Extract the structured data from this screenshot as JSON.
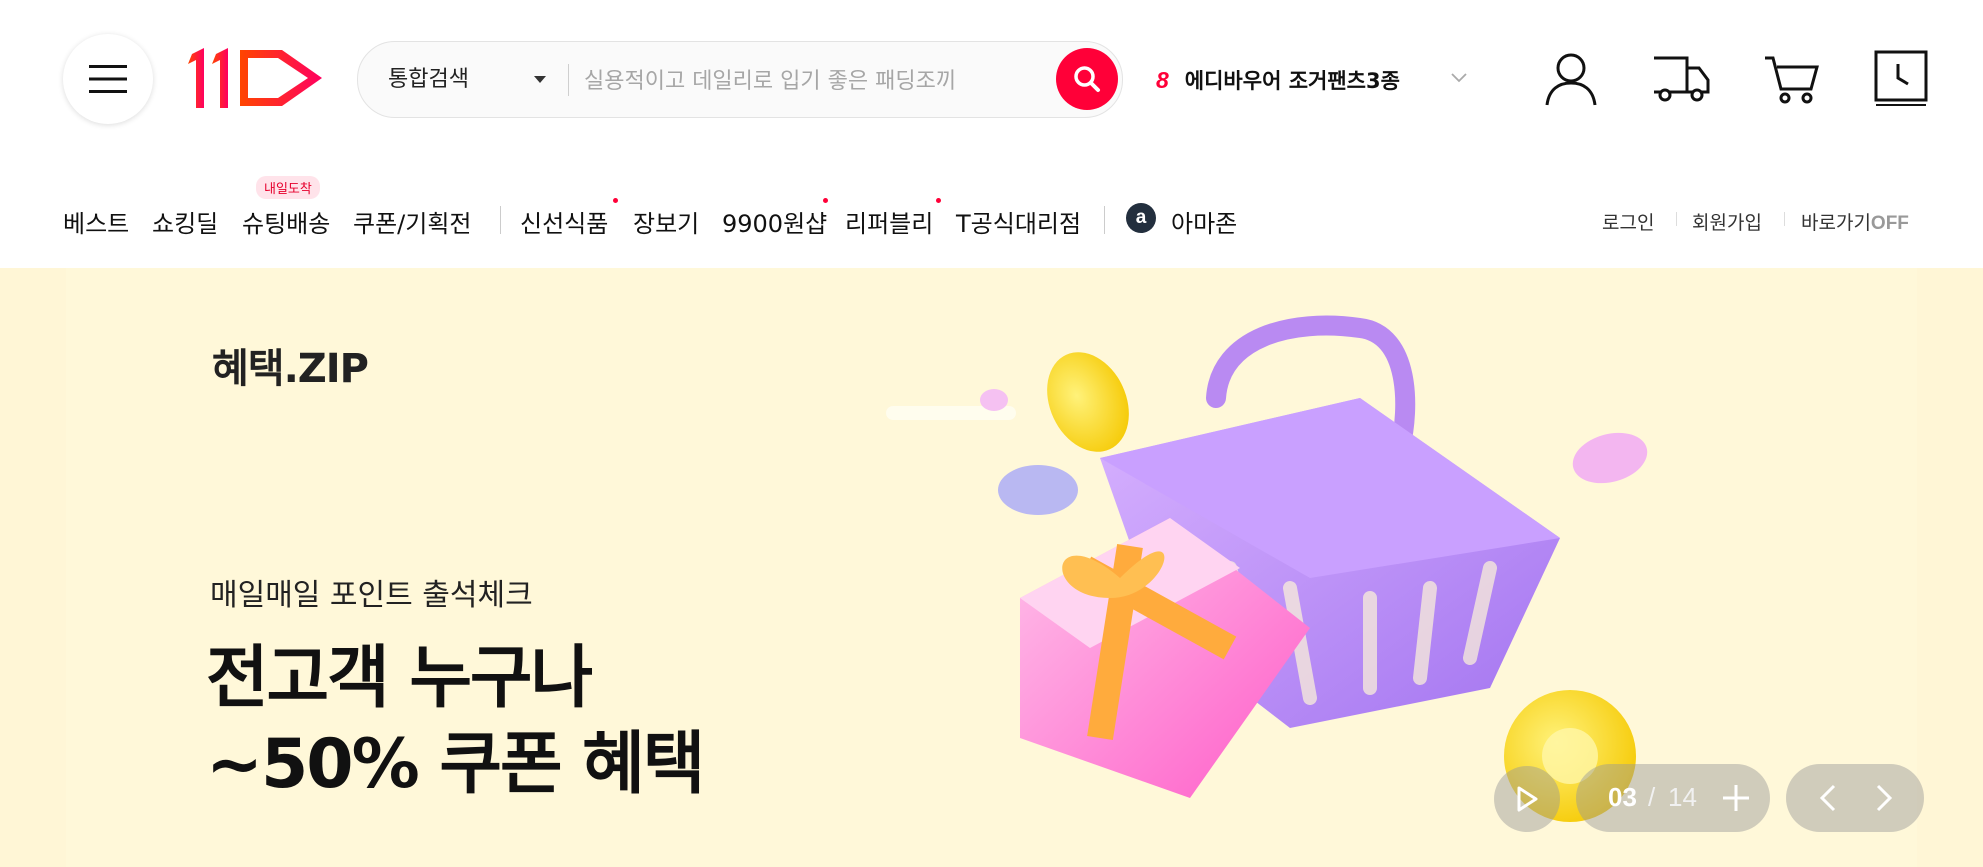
{
  "header": {
    "menu_icon": "hamburger-icon",
    "logo_text": "11",
    "search": {
      "category": "통합검색",
      "placeholder": "실용적이고 데일리로 입기 좋은 패딩조끼",
      "button_icon": "search-icon"
    },
    "rank": {
      "number": "8",
      "keyword": "에디바우어 조거팬츠3종"
    },
    "icons": [
      "user-icon",
      "truck-icon",
      "cart-icon",
      "recent-view-icon"
    ]
  },
  "nav": {
    "items": [
      {
        "label": "베스트"
      },
      {
        "label": "쇼킹딜"
      },
      {
        "label": "슈팅배송",
        "badge": "내일도착"
      },
      {
        "label": "쿠폰/기획전"
      },
      {
        "label": "신선식품"
      },
      {
        "label": "장보기"
      },
      {
        "label": "9900원샵"
      },
      {
        "label": "리퍼블리"
      },
      {
        "label": "T공식대리점"
      },
      {
        "label": "아마존",
        "logo": "a"
      }
    ],
    "utility": {
      "login": "로그인",
      "signup": "회원가입",
      "shortcut": "바로가기",
      "shortcut_state": "OFF"
    }
  },
  "banner": {
    "logo": "혜택.ZIP",
    "subtitle": "매일매일 포인트 출석체크",
    "title_line1": "전고객 누구나",
    "title_line2": "~50% 쿠폰 혜택",
    "pagination": {
      "current": "03",
      "separator": "/",
      "total": "14"
    },
    "colors": {
      "background": "#fff8d9",
      "accent": "#ff0038"
    }
  }
}
